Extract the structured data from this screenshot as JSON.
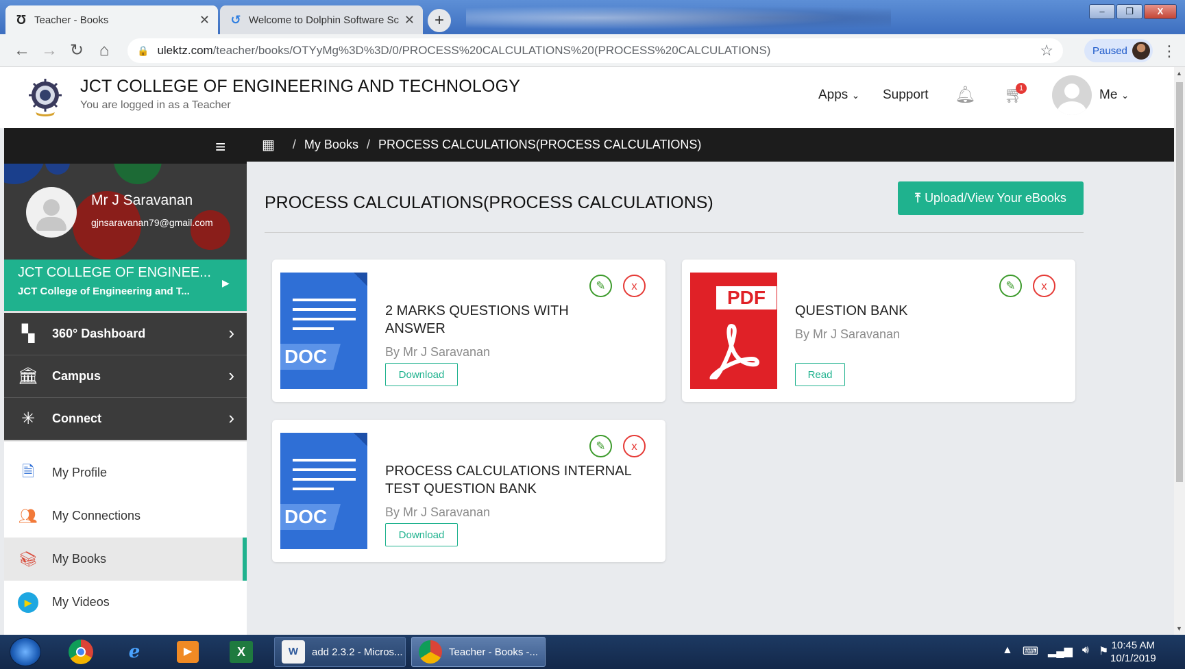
{
  "browser": {
    "tabs": [
      {
        "title": "Teacher - Books",
        "active": true
      },
      {
        "title": "Welcome to Dolphin Software Sc",
        "active": false
      }
    ],
    "new_tab": "+",
    "address": {
      "host": "ulektz.com",
      "path": "/teacher/books/OTYyMg%3D%3D/0/PROCESS%20CALCULATIONS%20(PROCESS%20CALCULATIONS)"
    },
    "profile_status": "Paused"
  },
  "header": {
    "college_name": "JCT COLLEGE OF ENGINEERING AND TECHNOLOGY",
    "login_info": "You are logged in as a Teacher",
    "nav": {
      "apps": "Apps",
      "support": "Support",
      "me": "Me"
    },
    "cart_count": "1"
  },
  "sidebar": {
    "profile": {
      "name": "Mr J Saravanan",
      "email": "gjnsaravanan79@gmail.com"
    },
    "college": {
      "title": "JCT COLLEGE OF ENGINEE...",
      "subtitle": "JCT College of Engineering and T..."
    },
    "main_menu": [
      {
        "label": "360° Dashboard",
        "icon": "dashboard-icon"
      },
      {
        "label": "Campus",
        "icon": "campus-icon"
      },
      {
        "label": "Connect",
        "icon": "connect-icon"
      }
    ],
    "sub_menu": [
      {
        "label": "My Profile",
        "icon": "profile-icon"
      },
      {
        "label": "My Connections",
        "icon": "connections-icon"
      },
      {
        "label": "My Books",
        "icon": "books-icon",
        "selected": true
      },
      {
        "label": "My Videos",
        "icon": "videos-icon"
      }
    ]
  },
  "breadcrumb": {
    "sep": "/",
    "items": [
      "My Books",
      "PROCESS CALCULATIONS(PROCESS CALCULATIONS)"
    ]
  },
  "main": {
    "title": "PROCESS CALCULATIONS(PROCESS CALCULATIONS)",
    "upload_label": "Upload/View Your eBooks",
    "books": [
      {
        "type": "DOC",
        "title": "2 MARKS QUESTIONS WITH ANSWER",
        "author": "By Mr J Saravanan",
        "action": "Download"
      },
      {
        "type": "PDF",
        "title": "QUESTION BANK",
        "author": "By Mr J Saravanan",
        "action": "Read"
      },
      {
        "type": "DOC",
        "title": "PROCESS CALCULATIONS INTERNAL TEST QUESTION BANK",
        "author": "By Mr J Saravanan",
        "action": "Download"
      }
    ]
  },
  "taskbar": {
    "tasks": [
      {
        "label": "add 2.3.2 - Micros..."
      },
      {
        "label": "Teacher - Books -..."
      }
    ],
    "clock": {
      "time": "10:45 AM",
      "date": "10/1/2019"
    }
  },
  "colors": {
    "accent": "#1fb28e",
    "dark_bar": "#1c1c1c",
    "menu_dark": "#3b3b3b",
    "pdf_red": "#e02127",
    "doc_blue": "#2f6fd6"
  }
}
